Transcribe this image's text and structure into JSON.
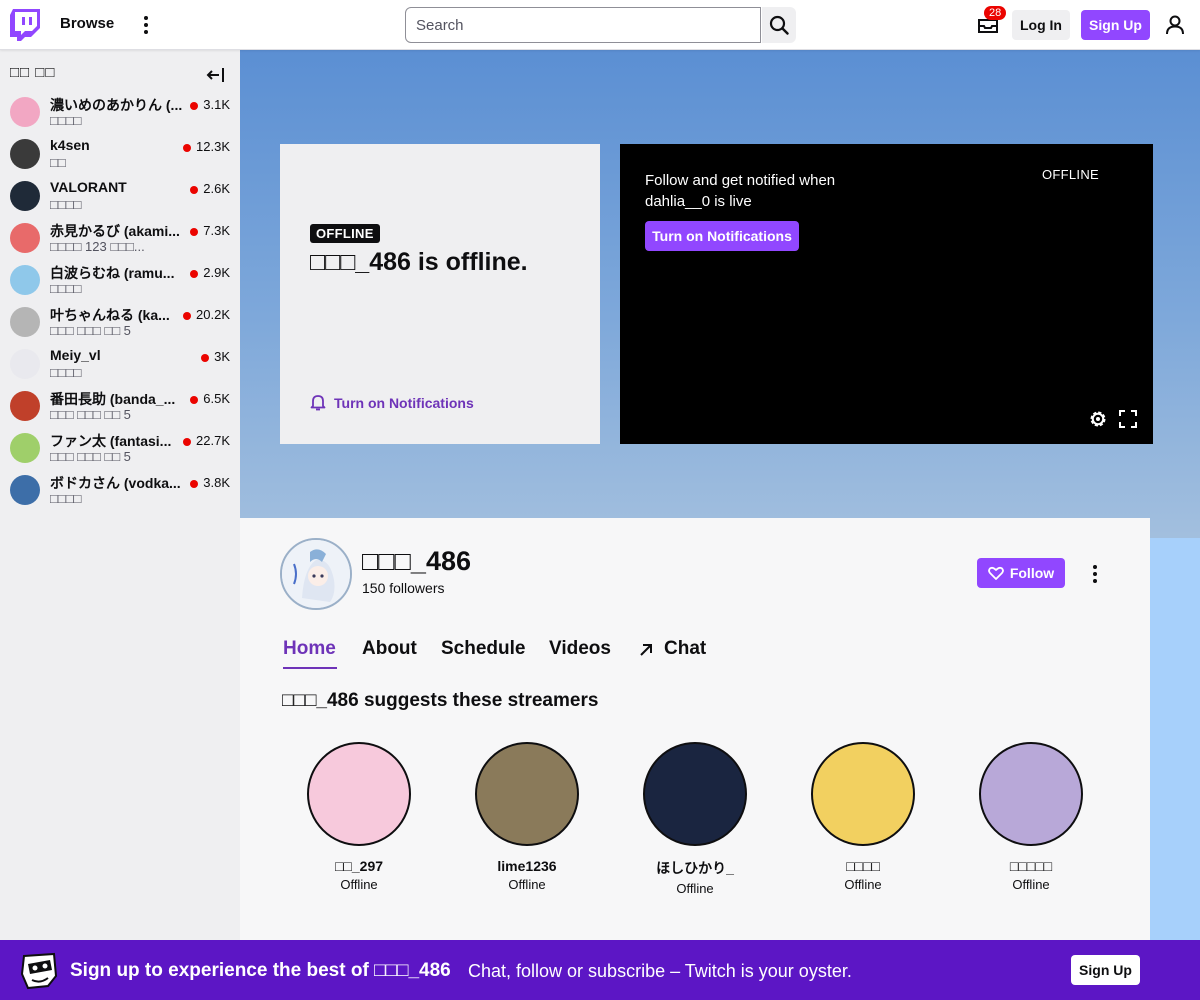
{
  "nav": {
    "browse_label": "Browse",
    "search_placeholder": "Search",
    "inbox_count": "28",
    "login_label": "Log In",
    "signup_label": "Sign Up",
    "accent": "#9147ff"
  },
  "sidebar": {
    "heading": "□□ □□",
    "channels": [
      {
        "name": "濃いめのあかりん (...",
        "category": "□□□□",
        "viewers": "3.1K"
      },
      {
        "name": "k4sen",
        "category": "□□",
        "viewers": "12.3K"
      },
      {
        "name": "VALORANT",
        "category": "□□□□",
        "viewers": "2.6K"
      },
      {
        "name": "赤見かるび (akami...",
        "category": "□□□□ 123 □□□...",
        "viewers": "7.3K"
      },
      {
        "name": "白波らむね (ramu...",
        "category": "□□□□",
        "viewers": "2.9K"
      },
      {
        "name": "叶ちゃんねる (ka...",
        "category": "□□□ □□□ □□ 5",
        "viewers": "20.2K"
      },
      {
        "name": "Meiy_vl",
        "category": "□□□□",
        "viewers": "3K"
      },
      {
        "name": "番田長助 (banda_...",
        "category": "□□□ □□□ □□ 5",
        "viewers": "6.5K"
      },
      {
        "name": "ファン太 (fantasi...",
        "category": "□□□ □□□ □□ 5",
        "viewers": "22.7K"
      },
      {
        "name": "ボドカさん (vodka...",
        "category": "□□□□",
        "viewers": "3.8K"
      }
    ]
  },
  "offline_card": {
    "pill": "OFFLINE",
    "title": "□□□_486 is offline.",
    "notify_label": "Turn on Notifications"
  },
  "player": {
    "message": "Follow and get notified when dahlia__0 is live",
    "button_label": "Turn on Notifications",
    "status": "OFFLINE"
  },
  "channel": {
    "name": "□□□_486",
    "followers": "150 followers",
    "follow_label": "Follow",
    "tabs": [
      "Home",
      "About",
      "Schedule",
      "Videos",
      "Chat"
    ],
    "suggest_title": "□□□_486 suggests these streamers",
    "suggestions": [
      {
        "name": "□□_297",
        "status": "Offline"
      },
      {
        "name": "lime1236",
        "status": "Offline"
      },
      {
        "name": "ほしひかり_",
        "status": "Offline"
      },
      {
        "name": "□□□□",
        "status": "Offline"
      },
      {
        "name": "□□□□□",
        "status": "Offline"
      }
    ]
  },
  "cta": {
    "bold": "Sign up to experience the best of □□□_486",
    "rest": "Chat, follow or subscribe – Twitch is your oyster.",
    "button_label": "Sign Up"
  }
}
